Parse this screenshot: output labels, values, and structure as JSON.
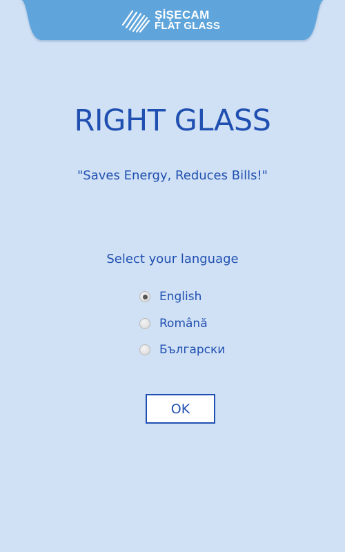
{
  "header": {
    "brand_line1": "ŞİŞECAM",
    "brand_line2": "FLAT GLASS",
    "logo_icon": "sisecam-lines-icon"
  },
  "main": {
    "title": "RIGHT GLASS",
    "slogan": "\"Saves Energy, Reduces Bills!\"",
    "language_prompt": "Select your language",
    "languages": [
      {
        "label": "English",
        "selected": true
      },
      {
        "label": "Română",
        "selected": false
      },
      {
        "label": "Български",
        "selected": false
      }
    ],
    "ok_label": "OK"
  },
  "colors": {
    "background": "#d1e1f5",
    "header_blue": "#5ea5db",
    "text_blue": "#1f4fb0"
  }
}
